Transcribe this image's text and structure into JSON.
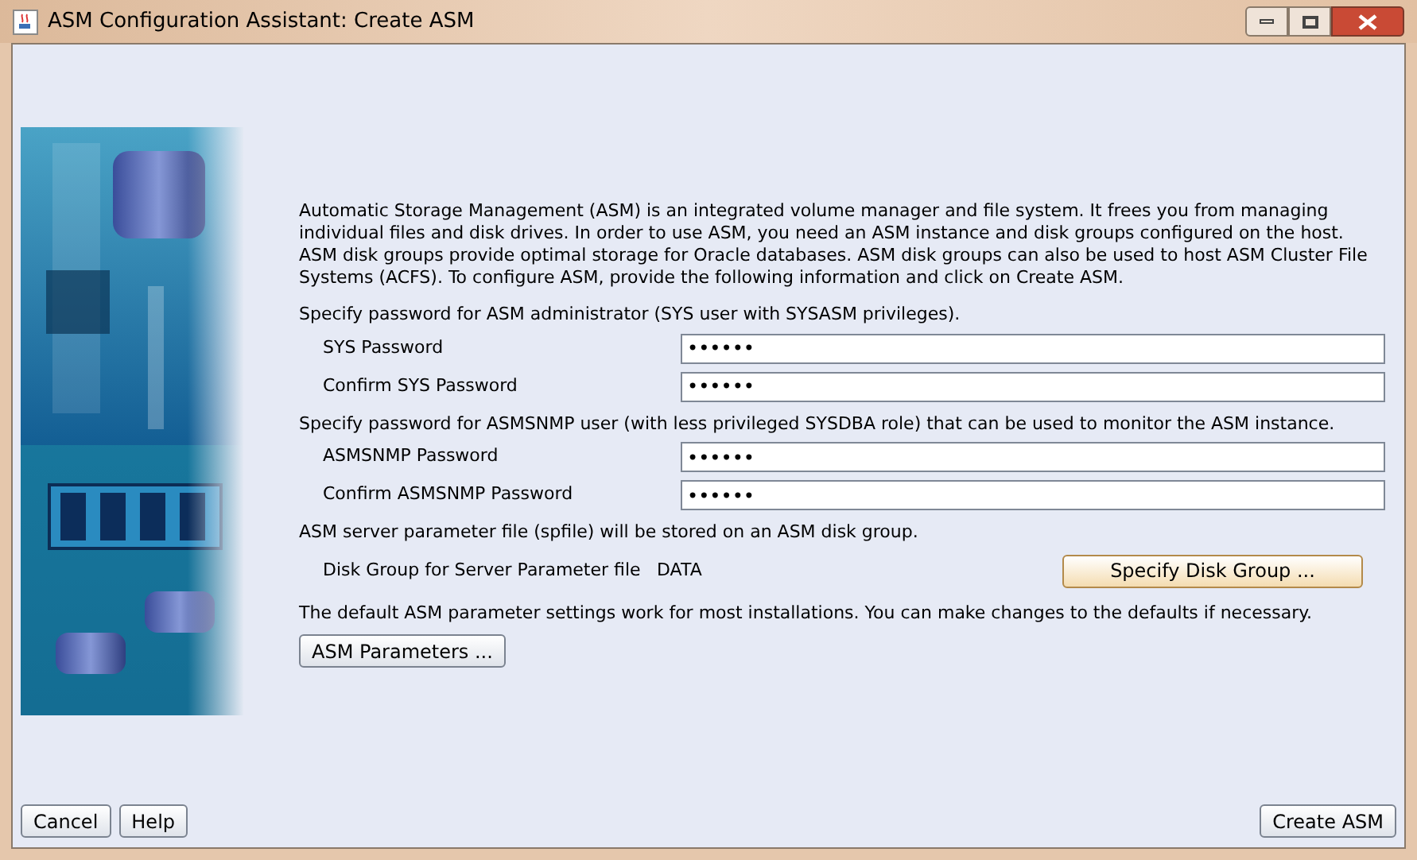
{
  "window": {
    "title": "ASM Configuration Assistant: Create ASM"
  },
  "intro": "Automatic Storage Management (ASM) is an integrated volume manager and file system. It frees you from managing individual files and disk drives. In order to use ASM, you need  an ASM instance and disk groups configured on the host.  ASM disk groups provide optimal storage for Oracle databases. ASM disk groups can also be used to host ASM Cluster File Systems (ACFS). To configure ASM, provide the following information and click on Create ASM.",
  "sections": [
    {
      "heading": "Specify password for ASM administrator (SYS user with SYSASM privileges).",
      "fields": [
        {
          "label": "SYS Password",
          "value": "••••••"
        },
        {
          "label": "Confirm SYS Password",
          "value": "••••••"
        }
      ]
    },
    {
      "heading": "Specify password for ASMSNMP user (with less privileged SYSDBA role) that can be used to monitor the ASM instance.",
      "fields": [
        {
          "label": "ASMSNMP Password",
          "value": "••••••"
        },
        {
          "label": "Confirm ASMSNMP Password",
          "value": "••••••"
        }
      ]
    }
  ],
  "spfile": {
    "heading": "ASM server parameter file (spfile) will be stored on an ASM disk group.",
    "label": "Disk Group for Server Parameter file",
    "value": "DATA",
    "button": "Specify Disk Group ..."
  },
  "parameters": {
    "text": "The default ASM parameter settings work for most installations. You can make changes to the defaults if necessary.",
    "button": "ASM Parameters ..."
  },
  "footer": {
    "left_buttons": [
      "Cancel",
      "Help"
    ],
    "primary_button": "Create ASM"
  }
}
